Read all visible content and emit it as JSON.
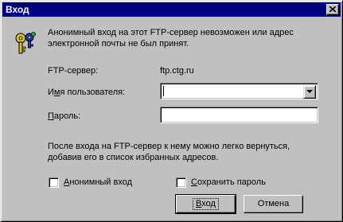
{
  "window": {
    "title": "Вход"
  },
  "message": "Анонимный вход на этот FTP-сервер  невозможен или адрес электронной почты не был принят.",
  "server": {
    "label": "FTP-сервер:",
    "value": "ftp.ctg.ru"
  },
  "username": {
    "label_pre": "И",
    "label_accel": "м",
    "label_post": "я пользователя:",
    "value": ""
  },
  "password": {
    "label_accel": "П",
    "label_post": "ароль:",
    "value": ""
  },
  "info": "После входа на FTP-сервер к нему можно легко вернуться, добавив его в список избранных адресов.",
  "anonymous": {
    "label_accel": "А",
    "label_post": "нонимный вход",
    "checked": false
  },
  "save_password": {
    "label_accel": "С",
    "label_post": "охранить пароль",
    "checked": false
  },
  "buttons": {
    "login_accel": "В",
    "login_post": "ход",
    "cancel": "Отмена"
  },
  "icons": {
    "keys": "keys-icon",
    "close": "close-icon",
    "dropdown": "chevron-down-icon"
  }
}
